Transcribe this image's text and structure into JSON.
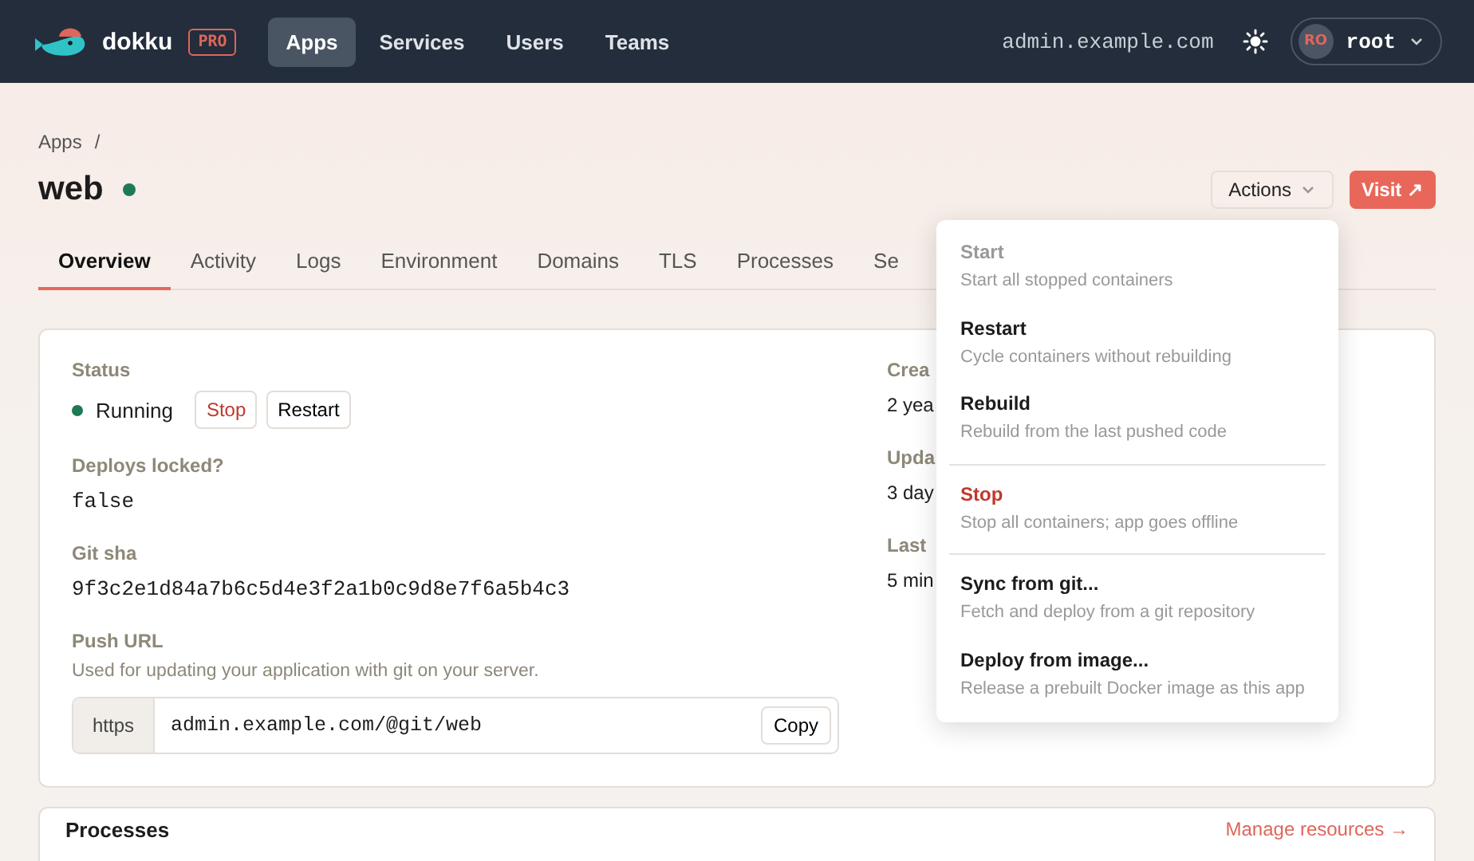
{
  "navbar": {
    "brand": "dokku",
    "badge": "PRO",
    "links": [
      {
        "label": "Apps",
        "selected": true
      },
      {
        "label": "Services",
        "selected": false
      },
      {
        "label": "Users",
        "selected": false
      },
      {
        "label": "Teams",
        "selected": false
      }
    ],
    "host": "admin.example.com",
    "user": {
      "initials": "RO",
      "name": "root"
    }
  },
  "breadcrumb": [
    "Apps",
    "/"
  ],
  "app": {
    "name": "web",
    "running": true
  },
  "header_buttons": {
    "actions": "Actions",
    "visit": "Visit ↗"
  },
  "tabs": [
    {
      "label": "Overview",
      "selected": true
    },
    {
      "label": "Activity",
      "selected": false
    },
    {
      "label": "Logs",
      "selected": false
    },
    {
      "label": "Environment",
      "selected": false
    },
    {
      "label": "Domains",
      "selected": false
    },
    {
      "label": "TLS",
      "selected": false
    },
    {
      "label": "Processes",
      "selected": false
    },
    {
      "label": "Se",
      "selected": false
    }
  ],
  "status": {
    "label": "Status",
    "value": "Running",
    "running": true,
    "stop": "Stop",
    "restart": "Restart"
  },
  "fields": [
    {
      "label": "Deploys locked?",
      "value": "false"
    },
    {
      "label": "Git sha",
      "value": "9f3c2e1d84a7b6c5d4e3f2a1b0c9d8e7f6a5b4c3"
    }
  ],
  "push_url": {
    "label": "Push URL",
    "help": "Used for updating your application with git on your server.",
    "prefix": "https",
    "value": "admin.example.com/@git/web",
    "copy": "Copy"
  },
  "side_fields": [
    {
      "label": "Crea",
      "value": "2 yea"
    },
    {
      "label": "Upda",
      "value": "3 day"
    },
    {
      "label": "Last",
      "value": "5 min"
    }
  ],
  "actions_menu": [
    [
      {
        "title": "Start",
        "description": "Start all stopped containers",
        "kind": "disabled"
      },
      {
        "title": "Restart",
        "description": "Cycle containers without rebuilding",
        "kind": "normal"
      },
      {
        "title": "Rebuild",
        "description": "Rebuild from the last pushed code",
        "kind": "normal"
      }
    ],
    [
      {
        "title": "Stop",
        "description": "Stop all containers; app goes offline",
        "kind": "danger"
      }
    ],
    [
      {
        "title": "Sync from git...",
        "description": "Fetch and deploy from a git repository",
        "kind": "normal"
      },
      {
        "title": "Deploy from image...",
        "description": "Release a prebuilt Docker image as this app",
        "kind": "normal"
      }
    ]
  ],
  "processes_card": {
    "title": "Processes",
    "link": "Manage resources →"
  }
}
